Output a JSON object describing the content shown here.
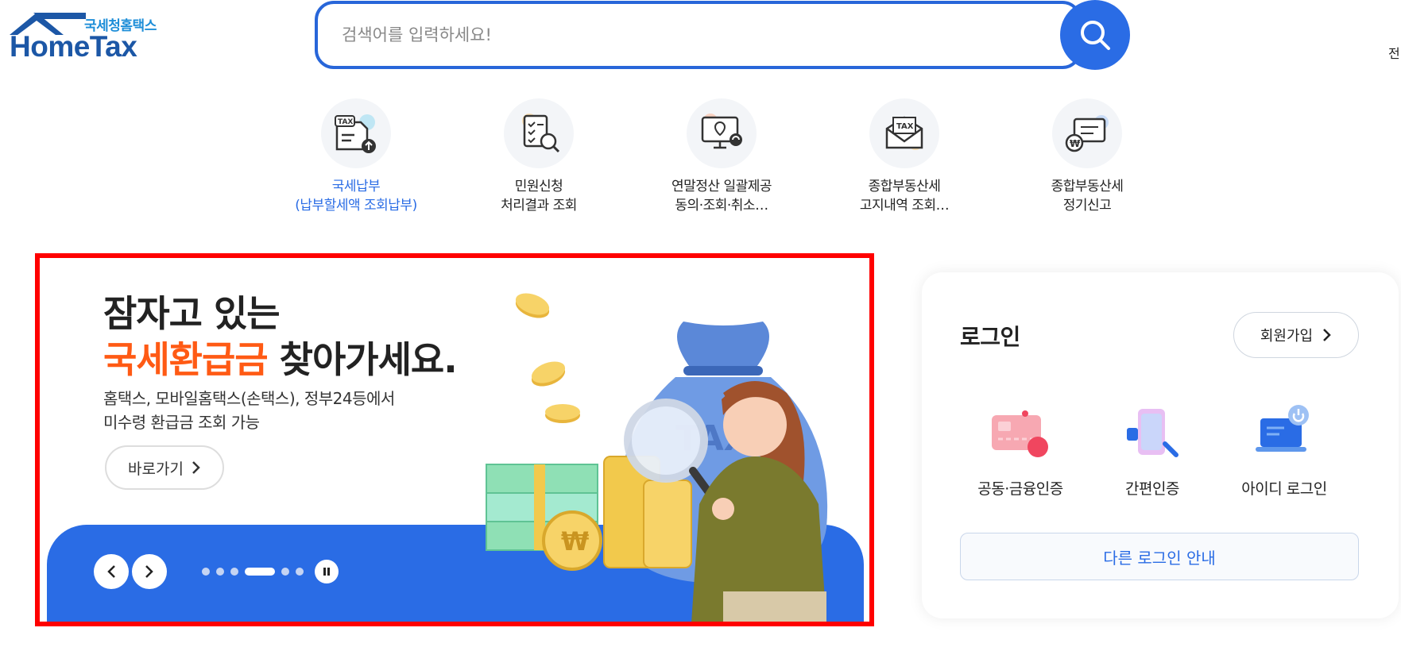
{
  "header": {
    "logo_sub": "국세청홈택스",
    "logo_main": "HomeTax",
    "search_placeholder": "검색어를 입력하세요!",
    "right_partial": "전"
  },
  "quick_menu": [
    {
      "label": "국세납부\n(납부할세액 조회납부)",
      "icon": "tax-payment-icon",
      "active": true
    },
    {
      "label": "민원신청\n처리결과 조회",
      "icon": "document-search-icon",
      "active": false
    },
    {
      "label": "연말정산 일괄제공\n동의·조회·취소…",
      "icon": "monitor-location-icon",
      "active": false
    },
    {
      "label": "종합부동산세\n고지내역 조회…",
      "icon": "tax-envelope-icon",
      "active": false
    },
    {
      "label": "종합부동산세\n정기신고",
      "icon": "won-document-icon",
      "active": false
    }
  ],
  "banner": {
    "line1": "잠자고 있는",
    "line2_accent": "국세환급금",
    "line2_rest": " 찾아가세요.",
    "description": "홈택스, 모바일홈택스(손택스), 정부24등에서\n미수령 환급금 조회 가능",
    "go_label": "바로가기",
    "bag_text": "TAX",
    "coin_symbol": "₩",
    "dots": 6,
    "active_dot": 3,
    "colors": {
      "accent": "#ff5a14",
      "blue": "#2a6ce5",
      "frame": "#ff0000"
    }
  },
  "login": {
    "title": "로그인",
    "join_label": "회원가입",
    "options": [
      {
        "label": "공동·금융인증",
        "icon": "certificate-card-icon"
      },
      {
        "label": "간편인증",
        "icon": "phone-search-icon"
      },
      {
        "label": "아이디 로그인",
        "icon": "laptop-power-icon"
      }
    ],
    "other_label": "다른 로그인 안내"
  }
}
